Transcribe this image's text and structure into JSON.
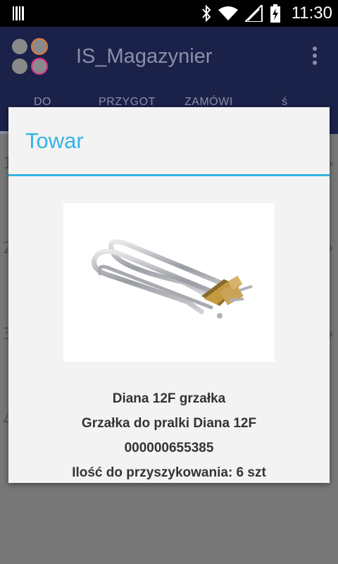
{
  "status_bar": {
    "time": "11:30",
    "icons": [
      "barcode-icon",
      "bluetooth-icon",
      "wifi-icon",
      "signal-icon",
      "battery-charging-icon"
    ]
  },
  "app": {
    "title": "IS_Magazynier",
    "logo_colors": [
      "#8a8a8a",
      "#e07a3a",
      "#8a8a8a",
      "#e0308a"
    ],
    "accent": "#33b5e5",
    "appbar_color": "#1b2249"
  },
  "tabs": [
    {
      "label": "DO"
    },
    {
      "label": "PRZYGOT"
    },
    {
      "label": "ZAMÓWI"
    },
    {
      "label": "ś"
    }
  ],
  "background_list": {
    "digits": [
      "1",
      "2",
      "3",
      "4"
    ]
  },
  "dialog": {
    "title": "Towar",
    "product": {
      "name": "Diana 12F grzałka",
      "description": "Grzałka do pralki Diana 12F",
      "code": "000000655385",
      "quantity": "Ilość do przyszykowania: 6 szt"
    }
  }
}
